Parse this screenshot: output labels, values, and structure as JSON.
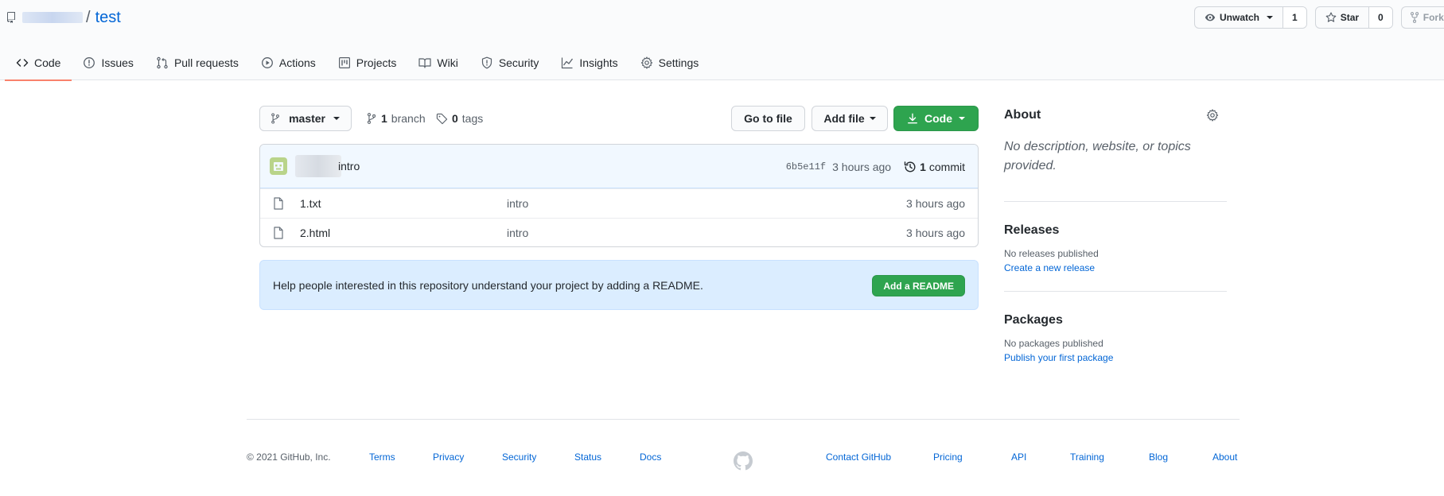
{
  "header": {
    "repo_name": "test",
    "slash": "/",
    "watch": {
      "label": "Unwatch",
      "count": "1"
    },
    "star": {
      "label": "Star",
      "count": "0"
    },
    "fork": {
      "label": "Fork"
    }
  },
  "tabs": [
    {
      "label": "Code",
      "icon": "code-icon"
    },
    {
      "label": "Issues",
      "icon": "issue-icon"
    },
    {
      "label": "Pull requests",
      "icon": "pull-request-icon"
    },
    {
      "label": "Actions",
      "icon": "play-icon"
    },
    {
      "label": "Projects",
      "icon": "project-icon"
    },
    {
      "label": "Wiki",
      "icon": "book-icon"
    },
    {
      "label": "Security",
      "icon": "shield-icon"
    },
    {
      "label": "Insights",
      "icon": "graph-icon"
    },
    {
      "label": "Settings",
      "icon": "gear-icon"
    }
  ],
  "branch_bar": {
    "branch": "master",
    "branch_count": "1",
    "branch_word": "branch",
    "tag_count": "0",
    "tag_word": "tags",
    "go_to_file": "Go to file",
    "add_file": "Add file",
    "code": "Code"
  },
  "commit": {
    "message": "intro",
    "sha": "6b5e11f",
    "age": "3 hours ago",
    "commit_count": "1",
    "commit_word": "commit"
  },
  "files": [
    {
      "name": "1.txt",
      "message": "intro",
      "age": "3 hours ago"
    },
    {
      "name": "2.html",
      "message": "intro",
      "age": "3 hours ago"
    }
  ],
  "readme": {
    "text": "Help people interested in this repository understand your project by adding a README.",
    "button": "Add a README"
  },
  "sidebar": {
    "about_title": "About",
    "about_desc": "No description, website, or topics provided.",
    "releases_title": "Releases",
    "releases_none": "No releases published",
    "releases_link": "Create a new release",
    "packages_title": "Packages",
    "packages_none": "No packages published",
    "packages_link": "Publish your first package"
  },
  "footer": {
    "copyright": "© 2021 GitHub, Inc.",
    "links_left": [
      "Terms",
      "Privacy",
      "Security",
      "Status",
      "Docs"
    ],
    "links_right": [
      "Contact GitHub",
      "Pricing",
      "API",
      "Training",
      "Blog",
      "About"
    ]
  },
  "colors": {
    "accent_green": "#2ea44f",
    "link_blue": "#0366d6",
    "tab_underline": "#f9826c",
    "readme_bg": "#dbedff"
  }
}
